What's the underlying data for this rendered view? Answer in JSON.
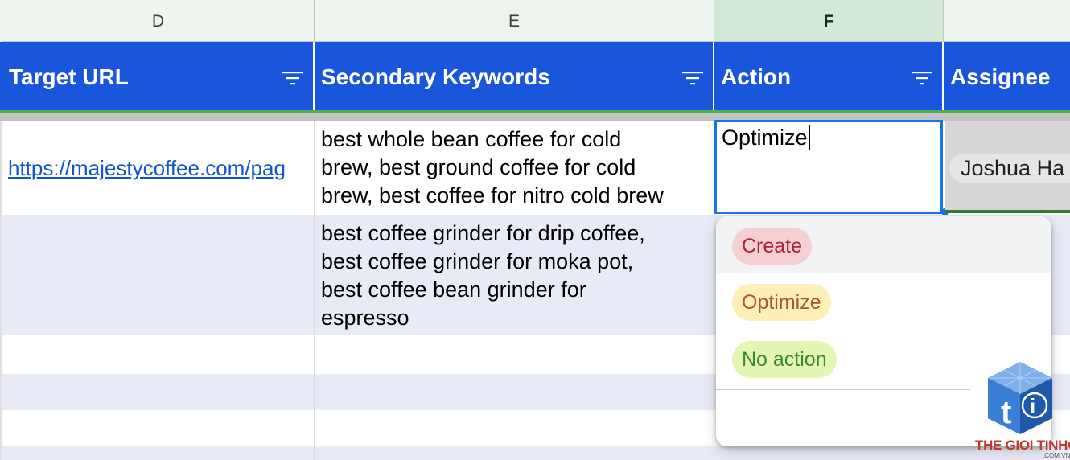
{
  "columns": {
    "d_letter": "D",
    "e_letter": "E",
    "f_letter": "F"
  },
  "headers": {
    "target_url": "Target URL",
    "secondary_keywords": "Secondary Keywords",
    "action": "Action",
    "assignee": "Assignee"
  },
  "rows": [
    {
      "target_url": "https://majestycoffee.com/pag",
      "keywords_lines": [
        "best whole bean coffee for cold",
        "brew, best ground coffee for cold",
        "brew, best coffee for nitro cold brew"
      ],
      "action_value": "Optimize",
      "assignee": "Joshua Ha"
    },
    {
      "target_url": "",
      "keywords_lines": [
        "best coffee grinder for drip coffee,",
        "best coffee grinder for moka pot,",
        "best coffee bean grinder for",
        "espresso"
      ]
    }
  ],
  "dropdown": {
    "options": [
      {
        "label": "Create",
        "color": "#b1213b",
        "bg": "#f6cfd3"
      },
      {
        "label": "Optimize",
        "color": "#a5582e",
        "bg": "#fdefb6"
      },
      {
        "label": "No action",
        "color": "#3c8c2c",
        "bg": "#e3f7b2"
      }
    ]
  },
  "watermark": {
    "brand": "THE GIOI TINHOC",
    "domain": ".COM.VN"
  },
  "colors": {
    "header_blue": "#1a56db",
    "selected_column": "#d3e9d7",
    "editor_border": "#1a73e8"
  }
}
